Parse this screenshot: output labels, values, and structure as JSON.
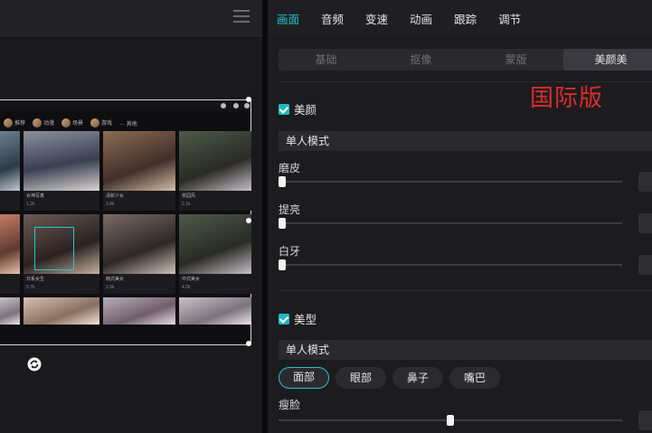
{
  "editor": {
    "tabs": [
      {
        "label": "画面",
        "active": true
      },
      {
        "label": "音频",
        "active": false
      },
      {
        "label": "变速",
        "active": false
      },
      {
        "label": "动画",
        "active": false
      },
      {
        "label": "跟踪",
        "active": false
      },
      {
        "label": "调节",
        "active": false
      }
    ],
    "subtabs": [
      {
        "label": "基础",
        "active": false
      },
      {
        "label": "抠像",
        "active": false
      },
      {
        "label": "蒙版",
        "active": false
      },
      {
        "label": "美颜美",
        "active": true
      }
    ],
    "watermark": "国际版",
    "beauty": {
      "label": "美颜",
      "mode": "单人模式",
      "sliders": [
        {
          "label": "磨皮",
          "value": 0
        },
        {
          "label": "提亮",
          "value": 0
        },
        {
          "label": "白牙",
          "value": 0
        }
      ]
    },
    "shape": {
      "label": "美型",
      "mode": "单人模式",
      "pills": [
        {
          "label": "面部",
          "active": true
        },
        {
          "label": "眼部",
          "active": false
        },
        {
          "label": "鼻子",
          "active": false
        },
        {
          "label": "嘴巴",
          "active": false
        }
      ],
      "slider": {
        "label": "瘦脸",
        "value": 0.5
      }
    }
  },
  "preview": {
    "filter_items": [
      "推荐",
      "动漫",
      "场景",
      "游戏",
      "其他"
    ],
    "tiles": [
      {
        "name": "",
        "sub": ""
      },
      {
        "name": "女神写真",
        "sub": "1.2k"
      },
      {
        "name": "清新少女",
        "sub": "3.4k"
      },
      {
        "name": "校园风",
        "sub": "2.1k"
      },
      {
        "name": "",
        "sub": ""
      },
      {
        "name": "日系女生",
        "sub": "5.7k"
      },
      {
        "name": "韩式美女",
        "sub": "1.9k"
      },
      {
        "name": "中式美女",
        "sub": "4.2k"
      }
    ]
  }
}
